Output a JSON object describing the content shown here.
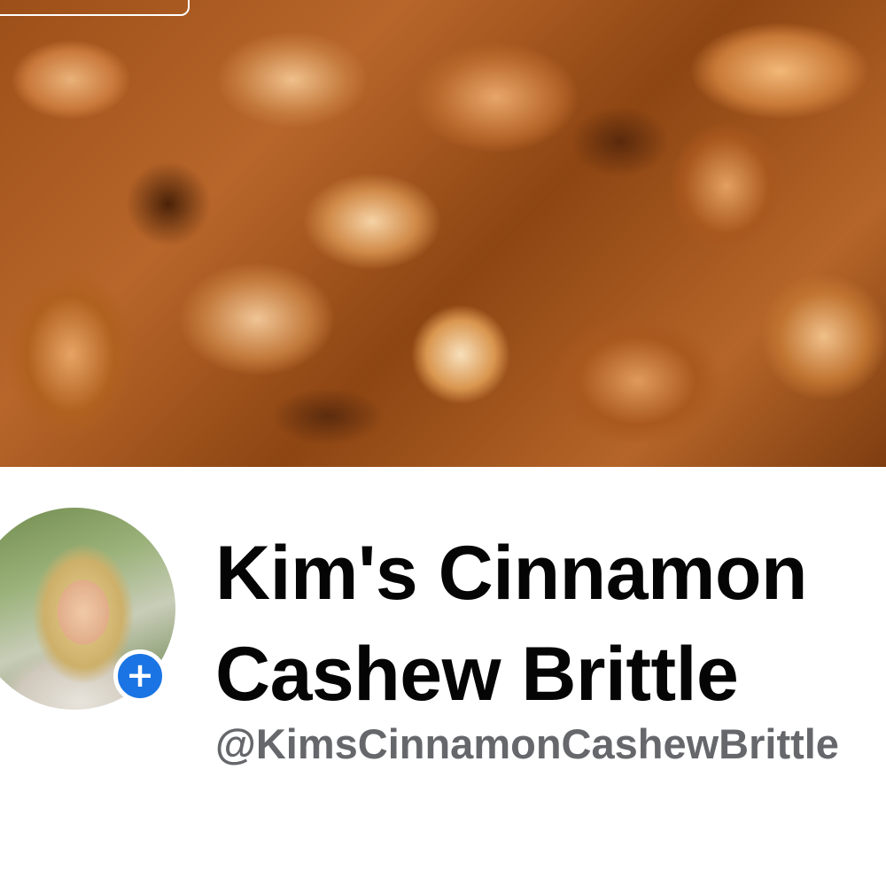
{
  "cover": {
    "icon": "cover-photo"
  },
  "profile": {
    "avatar_icon": "profile-photo",
    "add_glyph": "+",
    "add_icon": "plus-icon",
    "accent_color": "#1b74e4"
  },
  "page": {
    "name": "Kim's Cinnamon Cashew Brittle",
    "handle": "@KimsCinnamonCashewBrittle"
  },
  "colors": {
    "name_text": "#050505",
    "handle_text": "#65676b"
  }
}
